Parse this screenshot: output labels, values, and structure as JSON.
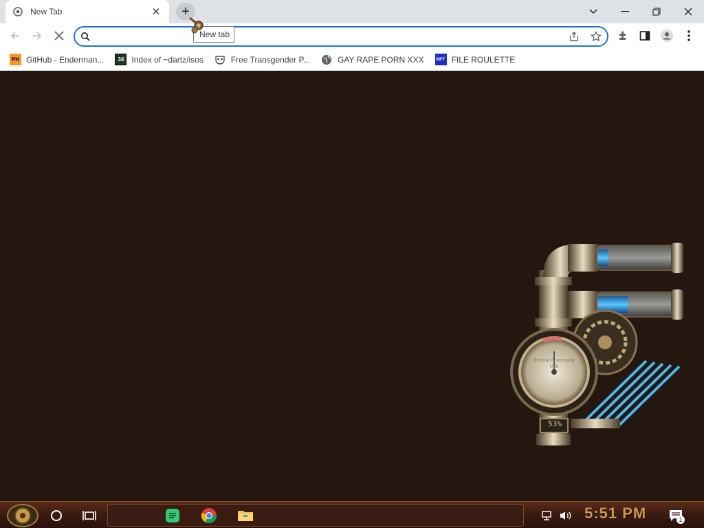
{
  "browser": {
    "tab": {
      "title": "New Tab"
    },
    "newtab_tooltip": "New tab",
    "omnibox": {
      "value": "",
      "placeholder": ""
    }
  },
  "bookmarks": [
    {
      "label": "GitHub - Enderman...",
      "icon": "ph-icon",
      "icon_text": "PH"
    },
    {
      "label": "Index of ~dartz/isos",
      "icon": "site-34-icon",
      "icon_text": "34"
    },
    {
      "label": "Free Transgender P...",
      "icon": "mask-icon",
      "icon_text": ""
    },
    {
      "label": "GAY RAPE PORN XXX",
      "icon": "globe-icon",
      "icon_text": ""
    },
    {
      "label": "FILE ROULETTE",
      "icon": "mft-icon",
      "icon_text": "MFT"
    }
  ],
  "gadget": {
    "cpu_percent": "53%",
    "dial_text": "Central Processing Unit"
  },
  "taskbar": {
    "time": "5:51 PM",
    "notification_count": "1"
  },
  "colors": {
    "accent": "#1a73e8",
    "desktop": "#23170f",
    "clock": "#c89a4a"
  }
}
